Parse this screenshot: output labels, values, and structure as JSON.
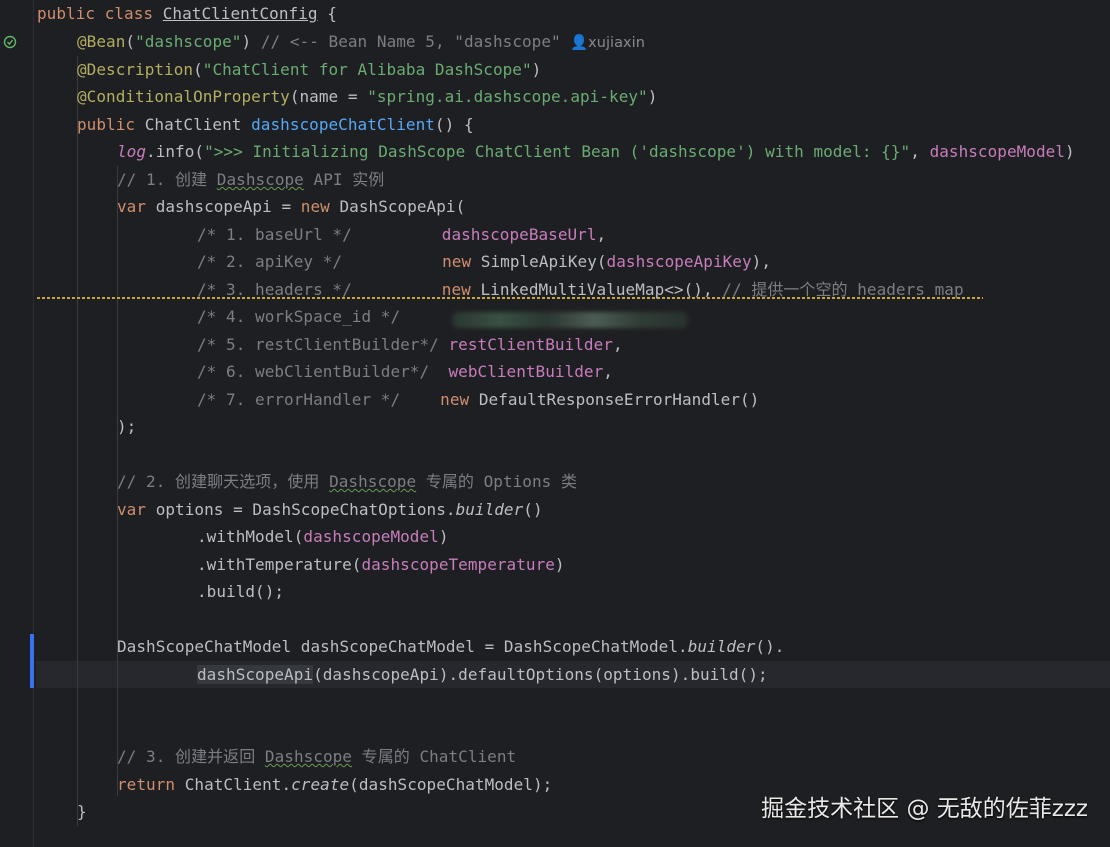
{
  "editor": {
    "author_hint": "xujiaxin",
    "lines": {
      "l1_kw": "public class ",
      "l1_class": "ChatClientConfig",
      "l1_rest": " {",
      "l2_ann": "@Bean",
      "l2_open": "(",
      "l2_str": "\"dashscope\"",
      "l2_close": ") ",
      "l2_cmt": "// <-- Bean Name 5, \"dashscope\"",
      "l3_ann": "@Description",
      "l3_open": "(",
      "l3_str": "\"ChatClient for Alibaba DashScope\"",
      "l3_close": ")",
      "l4_ann": "@ConditionalOnProperty",
      "l4_a": "(name = ",
      "l4_str": "\"spring.ai.dashscope.api-key\"",
      "l4_close": ")",
      "l5_kw": "public ",
      "l5_type": "ChatClient ",
      "l5_fn": "dashscopeChatClient",
      "l5_rest": "() {",
      "l6_log": "log",
      "l6_a": ".info(",
      "l6_str": "\">>> Initializing DashScope ChatClient Bean ('dashscope') with model: {}\"",
      "l6_b": ", ",
      "l6_fld": "dashscopeModel",
      "l6_c": ")",
      "l7_cmt_a": "// 1. 创建 ",
      "l7_cmt_b": "Dashscope",
      "l7_cmt_c": " API 实例",
      "l8_kw": "var ",
      "l8_a": "dashscopeApi = ",
      "l8_kw2": "new ",
      "l8_b": "DashScopeApi(",
      "l9_cmt": "/* 1. baseUrl */",
      "l9_fld": "dashscopeBaseUrl",
      "l9_rest": ",",
      "l10_cmt": "/* 2. apiKey */",
      "l10_kw": "new ",
      "l10_a": "SimpleApiKey(",
      "l10_fld": "dashscopeApiKey",
      "l10_rest": "),",
      "l11_cmt": "/* 3. headers */",
      "l11_kw": "new ",
      "l11_a": "LinkedMultiValueMap<>(), ",
      "l11_cmt2": "// 提供一个空的 headers map",
      "l12_cmt": "/* 4. workSpace_id */",
      "l13_cmt": "/* 5. restClientBuilder*/ ",
      "l13_fld": "restClientBuilder",
      "l13_rest": ",",
      "l14_cmt": "/* 6. webClientBuilder*/  ",
      "l14_fld": "webClientBuilder",
      "l14_rest": ",",
      "l15_cmt": "/* 7. errorHandler */",
      "l15_kw": "new ",
      "l15_a": "DefaultResponseErrorHandler()",
      "l16": ");",
      "l18_cmt_a": "// 2. 创建聊天选项，使用 ",
      "l18_cmt_b": "Dashscope",
      "l18_cmt_c": " 专属的 Options 类",
      "l19_kw": "var ",
      "l19_a": "options = DashScopeChatOptions.",
      "l19_it": "builder",
      "l19_rest": "()",
      "l20_a": ".withModel(",
      "l20_fld": "dashscopeModel",
      "l20_rest": ")",
      "l21_a": ".withTemperature(",
      "l21_fld": "dashscopeTemperature",
      "l21_rest": ")",
      "l22": ".build();",
      "l24_a": "DashScopeChatModel dashScopeChatModel = DashScopeChatModel.",
      "l24_it": "builder",
      "l24_rest": "().",
      "l25_tok": "dashScopeApi",
      "l25_rest": "(dashscopeApi).defaultOptions(options).build();",
      "l28_cmt_a": "// 3. 创建并返回 ",
      "l28_cmt_b": "Dashscope",
      "l28_cmt_c": " 专属的 ChatClient",
      "l29_kw": "return ",
      "l29_a": "ChatClient.",
      "l29_it": "create",
      "l29_rest": "(dashScopeChatModel);",
      "l30": "}"
    }
  },
  "watermark": "掘金技术社区 @ 无敌的佐菲zzz"
}
